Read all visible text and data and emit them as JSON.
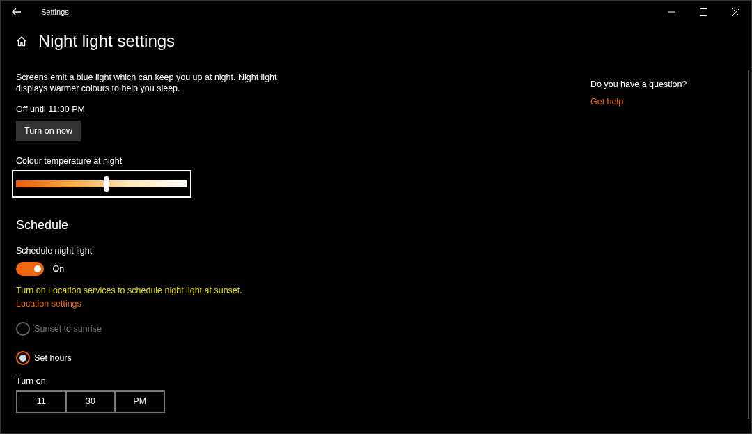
{
  "window": {
    "title": "Settings"
  },
  "page": {
    "title": "Night light settings",
    "description": "Screens emit a blue light which can keep you up at night. Night light displays warmer colours to help you sleep.",
    "status": "Off until 11:30 PM",
    "button": "Turn on now"
  },
  "slider": {
    "label": "Colour temperature at night",
    "level": 0.53
  },
  "schedule": {
    "heading": "Schedule",
    "toggle_label": "Schedule night light",
    "toggle_on": true,
    "toggle_text": "On",
    "warning": "Turn on Location services to schedule night light at sunset.",
    "link": "Location settings"
  },
  "radios": [
    {
      "label": "Sunset to sunrise",
      "selected": false,
      "disabled": true
    },
    {
      "label": "Set hours",
      "selected": true,
      "disabled": false
    }
  ],
  "turn_on": {
    "label": "Turn on",
    "parts": [
      "11",
      "30",
      "PM"
    ]
  },
  "help": {
    "question": "Do you have a question?",
    "link": "Get help"
  }
}
